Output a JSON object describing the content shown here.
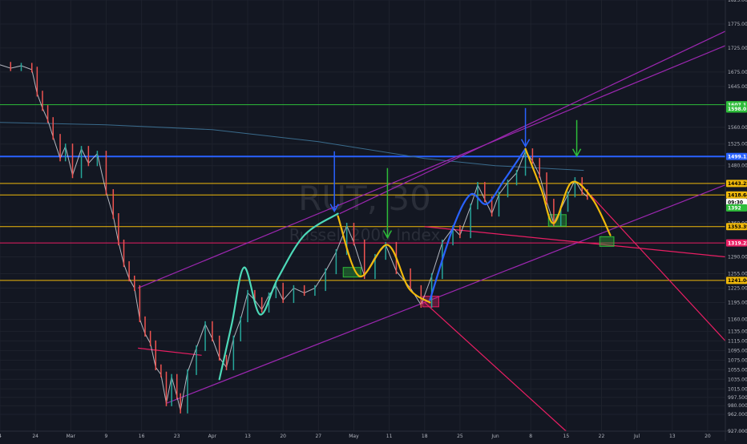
{
  "watermark": {
    "symbol": "RUT, 30",
    "name": "Russell 2000 Index"
  },
  "chart_data": {
    "type": "line",
    "title": "",
    "xlabel": "",
    "ylabel": "",
    "x_ticks": [
      {
        "t": 0,
        "label": "4"
      },
      {
        "t": 1,
        "label": "24"
      },
      {
        "t": 2,
        "label": "Mar"
      },
      {
        "t": 3,
        "label": "9"
      },
      {
        "t": 4,
        "label": "16"
      },
      {
        "t": 5,
        "label": "23"
      },
      {
        "t": 6,
        "label": "Apr"
      },
      {
        "t": 7,
        "label": "13"
      },
      {
        "t": 8,
        "label": "20"
      },
      {
        "t": 9,
        "label": "27"
      },
      {
        "t": 10,
        "label": "May"
      },
      {
        "t": 11,
        "label": "11"
      },
      {
        "t": 12,
        "label": "18"
      },
      {
        "t": 13,
        "label": "25"
      },
      {
        "t": 14,
        "label": "Jun"
      },
      {
        "t": 15,
        "label": "8"
      },
      {
        "t": 16,
        "label": "15"
      },
      {
        "t": 17,
        "label": "22"
      },
      {
        "t": 18,
        "label": "Jul"
      },
      {
        "t": 19,
        "label": "13"
      },
      {
        "t": 20,
        "label": "20"
      }
    ],
    "y_ticks": [
      {
        "v": 1825,
        "label": "1825.000"
      },
      {
        "v": 1775,
        "label": "1775.000"
      },
      {
        "v": 1725,
        "label": "1725.000"
      },
      {
        "v": 1675,
        "label": "1675.000"
      },
      {
        "v": 1645,
        "label": "1645.000"
      },
      {
        "v": 1560,
        "label": "1560.000"
      },
      {
        "v": 1525,
        "label": "1525.000"
      },
      {
        "v": 1480,
        "label": "1480.000"
      },
      {
        "v": 1360,
        "label": "1360.000"
      },
      {
        "v": 1290,
        "label": "1290.000"
      },
      {
        "v": 1255,
        "label": "1255.000"
      },
      {
        "v": 1225,
        "label": "1225.000"
      },
      {
        "v": 1195,
        "label": "1195.000"
      },
      {
        "v": 1160,
        "label": "1160.000"
      },
      {
        "v": 1135,
        "label": "1135.000"
      },
      {
        "v": 1115,
        "label": "1115.000"
      },
      {
        "v": 1095,
        "label": "1095.000"
      },
      {
        "v": 1075,
        "label": "1075.000"
      },
      {
        "v": 1055,
        "label": "1055.000"
      },
      {
        "v": 1035,
        "label": "1035.000"
      },
      {
        "v": 1015,
        "label": "1015.000"
      },
      {
        "v": 997.5,
        "label": "997.500"
      },
      {
        "v": 980,
        "label": "980.000"
      },
      {
        "v": 962,
        "label": "962.000"
      },
      {
        "v": 927,
        "label": "927.000"
      }
    ],
    "price_tags": [
      {
        "v": 1607,
        "label": "1607.1",
        "bg": "#2ebd3a",
        "fg": "#ffffff"
      },
      {
        "v": 1598,
        "label": "1598.0",
        "bg": "#2ebd3a",
        "fg": "#ffffff"
      },
      {
        "v": 1499,
        "label": "1499.117",
        "bg": "#2962ff",
        "fg": "#ffffff"
      },
      {
        "v": 1443,
        "label": "1443.252",
        "bg": "#f0b90b",
        "fg": "#000000"
      },
      {
        "v": 1419,
        "label": "1418.640",
        "bg": "#f0b90b",
        "fg": "#000000"
      },
      {
        "v": 1404,
        "label": "09:30",
        "bg": "#ffffff",
        "fg": "#000000"
      },
      {
        "v": 1392,
        "label": "1392",
        "bg": "#2ebd3a",
        "fg": "#ffffff"
      },
      {
        "v": 1353,
        "label": "1353.391",
        "bg": "#f0b90b",
        "fg": "#000000"
      },
      {
        "v": 1319,
        "label": "1319.224",
        "bg": "#e91e63",
        "fg": "#ffffff"
      },
      {
        "v": 1241,
        "label": "1241.042",
        "bg": "#f0b90b",
        "fg": "#000000"
      }
    ],
    "horizontal_levels": [
      {
        "v": 1607,
        "color": "#2ebd3a"
      },
      {
        "v": 1499,
        "color": "#2962ff"
      },
      {
        "v": 1443,
        "color": "#f0b90b"
      },
      {
        "v": 1419,
        "color": "#f0b90b"
      },
      {
        "v": 1353,
        "color": "#f0b90b"
      },
      {
        "v": 1319,
        "color": "#e91e63"
      },
      {
        "v": 1241,
        "color": "#f0b90b"
      }
    ],
    "price_series": [
      {
        "t": 0.0,
        "v": 1690
      },
      {
        "t": 0.3,
        "v": 1683
      },
      {
        "t": 0.6,
        "v": 1688
      },
      {
        "t": 0.9,
        "v": 1680
      },
      {
        "t": 1.05,
        "v": 1630
      },
      {
        "t": 1.2,
        "v": 1600
      },
      {
        "t": 1.35,
        "v": 1575
      },
      {
        "t": 1.5,
        "v": 1540
      },
      {
        "t": 1.7,
        "v": 1495
      },
      {
        "t": 1.85,
        "v": 1520
      },
      {
        "t": 2.05,
        "v": 1460
      },
      {
        "t": 2.3,
        "v": 1515
      },
      {
        "t": 2.5,
        "v": 1485
      },
      {
        "t": 2.75,
        "v": 1505
      },
      {
        "t": 3.0,
        "v": 1425
      },
      {
        "t": 3.2,
        "v": 1375
      },
      {
        "t": 3.35,
        "v": 1320
      },
      {
        "t": 3.5,
        "v": 1275
      },
      {
        "t": 3.65,
        "v": 1245
      },
      {
        "t": 3.8,
        "v": 1225
      },
      {
        "t": 3.95,
        "v": 1160
      },
      {
        "t": 4.1,
        "v": 1130
      },
      {
        "t": 4.25,
        "v": 1110
      },
      {
        "t": 4.4,
        "v": 1060
      },
      {
        "t": 4.55,
        "v": 1045
      },
      {
        "t": 4.7,
        "v": 985
      },
      {
        "t": 4.85,
        "v": 1040
      },
      {
        "t": 5.0,
        "v": 1000
      },
      {
        "t": 5.1,
        "v": 970
      },
      {
        "t": 5.3,
        "v": 1050
      },
      {
        "t": 5.55,
        "v": 1100
      },
      {
        "t": 5.8,
        "v": 1150
      },
      {
        "t": 6.0,
        "v": 1120
      },
      {
        "t": 6.2,
        "v": 1080
      },
      {
        "t": 6.4,
        "v": 1060
      },
      {
        "t": 6.6,
        "v": 1120
      },
      {
        "t": 6.8,
        "v": 1160
      },
      {
        "t": 7.0,
        "v": 1215
      },
      {
        "t": 7.2,
        "v": 1200
      },
      {
        "t": 7.4,
        "v": 1180
      },
      {
        "t": 7.6,
        "v": 1210
      },
      {
        "t": 7.8,
        "v": 1230
      },
      {
        "t": 8.0,
        "v": 1200
      },
      {
        "t": 8.3,
        "v": 1225
      },
      {
        "t": 8.6,
        "v": 1215
      },
      {
        "t": 8.9,
        "v": 1225
      },
      {
        "t": 9.2,
        "v": 1260
      },
      {
        "t": 9.5,
        "v": 1300
      },
      {
        "t": 9.8,
        "v": 1355
      },
      {
        "t": 10.0,
        "v": 1320
      },
      {
        "t": 10.3,
        "v": 1250
      },
      {
        "t": 10.6,
        "v": 1290
      },
      {
        "t": 10.9,
        "v": 1315
      },
      {
        "t": 11.2,
        "v": 1260
      },
      {
        "t": 11.6,
        "v": 1225
      },
      {
        "t": 11.9,
        "v": 1190
      },
      {
        "t": 12.2,
        "v": 1250
      },
      {
        "t": 12.5,
        "v": 1320
      },
      {
        "t": 12.8,
        "v": 1350
      },
      {
        "t": 13.0,
        "v": 1335
      },
      {
        "t": 13.3,
        "v": 1395
      },
      {
        "t": 13.5,
        "v": 1440
      },
      {
        "t": 13.7,
        "v": 1410
      },
      {
        "t": 13.9,
        "v": 1380
      },
      {
        "t": 14.1,
        "v": 1420
      },
      {
        "t": 14.35,
        "v": 1445
      },
      {
        "t": 14.6,
        "v": 1465
      },
      {
        "t": 14.85,
        "v": 1510
      },
      {
        "t": 15.05,
        "v": 1490
      },
      {
        "t": 15.25,
        "v": 1460
      },
      {
        "t": 15.45,
        "v": 1405
      },
      {
        "t": 15.65,
        "v": 1360
      },
      {
        "t": 15.85,
        "v": 1390
      },
      {
        "t": 16.05,
        "v": 1420
      },
      {
        "t": 16.25,
        "v": 1450
      },
      {
        "t": 16.45,
        "v": 1425
      },
      {
        "t": 16.6,
        "v": 1415
      }
    ],
    "patterns": [
      {
        "color": "#4dd9b8",
        "points": [
          {
            "t": 6.2,
            "v": 1035
          },
          {
            "t": 6.55,
            "v": 1150
          },
          {
            "t": 6.9,
            "v": 1268
          },
          {
            "t": 7.35,
            "v": 1170
          },
          {
            "t": 7.85,
            "v": 1245
          },
          {
            "t": 8.6,
            "v": 1335
          },
          {
            "t": 9.55,
            "v": 1380
          }
        ]
      },
      {
        "color": "#f0b90b",
        "points": [
          {
            "t": 9.55,
            "v": 1375
          },
          {
            "t": 10.15,
            "v": 1250
          },
          {
            "t": 10.95,
            "v": 1315
          },
          {
            "t": 11.55,
            "v": 1225
          },
          {
            "t": 12.15,
            "v": 1195
          }
        ]
      },
      {
        "color": "#2962ff",
        "points": [
          {
            "t": 12.15,
            "v": 1200
          },
          {
            "t": 12.8,
            "v": 1350
          },
          {
            "t": 13.3,
            "v": 1420
          },
          {
            "t": 13.75,
            "v": 1400
          },
          {
            "t": 14.25,
            "v": 1450
          },
          {
            "t": 14.85,
            "v": 1515
          }
        ]
      },
      {
        "color": "#f0b90b",
        "points": [
          {
            "t": 14.85,
            "v": 1515
          },
          {
            "t": 15.3,
            "v": 1430
          },
          {
            "t": 15.65,
            "v": 1360
          },
          {
            "t": 16.15,
            "v": 1445
          },
          {
            "t": 16.75,
            "v": 1410
          },
          {
            "t": 17.25,
            "v": 1335
          }
        ]
      }
    ],
    "channels": [
      {
        "color": "#9c27b0",
        "from": {
          "t": 3.9,
          "v": 1225
        },
        "to": {
          "t": 20.5,
          "v": 1730
        }
      },
      {
        "color": "#9c27b0",
        "from": {
          "t": 4.7,
          "v": 985
        },
        "to": {
          "t": 20.5,
          "v": 1440
        }
      },
      {
        "color": "#9c27b0",
        "from": {
          "t": 9.6,
          "v": 1380
        },
        "to": {
          "t": 20.5,
          "v": 1760
        }
      }
    ],
    "trendlines": [
      {
        "color": "#e91e63",
        "from": {
          "t": 12.0,
          "v": 1195
        },
        "to": {
          "t": 16.0,
          "v": 927
        }
      },
      {
        "color": "#e91e63",
        "from": {
          "t": 16.7,
          "v": 1418
        },
        "to": {
          "t": 20.5,
          "v": 1115
        }
      },
      {
        "color": "#e91e63",
        "from": {
          "t": 3.9,
          "v": 1100
        },
        "to": {
          "t": 5.7,
          "v": 1085
        }
      },
      {
        "color": "#e91e63",
        "from": {
          "t": 12.0,
          "v": 1353
        },
        "to": {
          "t": 20.5,
          "v": 1290
        }
      }
    ],
    "moving_average": [
      {
        "t": 0.0,
        "v": 1570
      },
      {
        "t": 3.0,
        "v": 1565
      },
      {
        "t": 6.0,
        "v": 1555
      },
      {
        "t": 9.0,
        "v": 1530
      },
      {
        "t": 12.0,
        "v": 1495
      },
      {
        "t": 14.0,
        "v": 1480
      },
      {
        "t": 16.5,
        "v": 1470
      }
    ],
    "arrows": [
      {
        "color": "#2962ff",
        "t": 9.45,
        "v_from": 1510,
        "v_to": 1385
      },
      {
        "color": "#2ebd3a",
        "t": 10.95,
        "v_from": 1475,
        "v_to": 1330
      },
      {
        "color": "#2962ff",
        "t": 14.85,
        "v_from": 1600,
        "v_to": 1520
      },
      {
        "color": "#2ebd3a",
        "t": 16.3,
        "v_from": 1575,
        "v_to": 1500
      }
    ],
    "boxes": [
      {
        "color": "#2ebd3a",
        "t0": 9.7,
        "t1": 10.2,
        "v0": 1268,
        "v1": 1248
      },
      {
        "color": "#e91e63",
        "t0": 11.95,
        "t1": 12.4,
        "v0": 1208,
        "v1": 1186
      },
      {
        "color": "#2ebd3a",
        "t0": 15.5,
        "t1": 16.0,
        "v0": 1378,
        "v1": 1354
      },
      {
        "color": "#2ebd3a",
        "t0": 16.95,
        "t1": 17.35,
        "v0": 1332,
        "v1": 1312
      }
    ],
    "ylim": [
      927,
      1825
    ],
    "xlim": [
      0,
      20.5
    ]
  }
}
